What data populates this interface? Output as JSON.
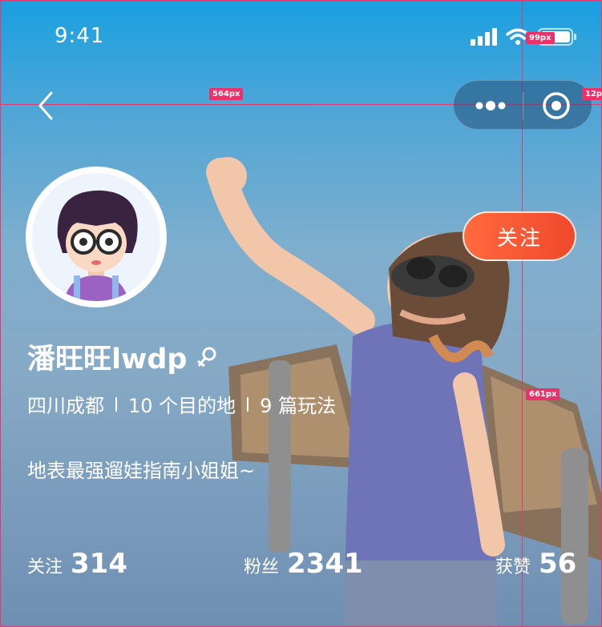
{
  "status_bar": {
    "time": "9:41"
  },
  "measurements": {
    "m1": "564px",
    "m2": "99px",
    "m3": "12p",
    "m4": "661px"
  },
  "profile": {
    "name": "潘旺旺lwdp",
    "location": "四川成都",
    "destinations": "10 个目的地",
    "guides": "9 篇玩法",
    "bio": "地表最强遛娃指南小姐姐~",
    "follow_label": "关注"
  },
  "stats": [
    {
      "label": "关注",
      "value": "314"
    },
    {
      "label": "粉丝",
      "value": "2341"
    },
    {
      "label": "获赞",
      "value": "56"
    }
  ],
  "colors": {
    "accent": "#f0482d",
    "ruler": "#e03a6f"
  }
}
